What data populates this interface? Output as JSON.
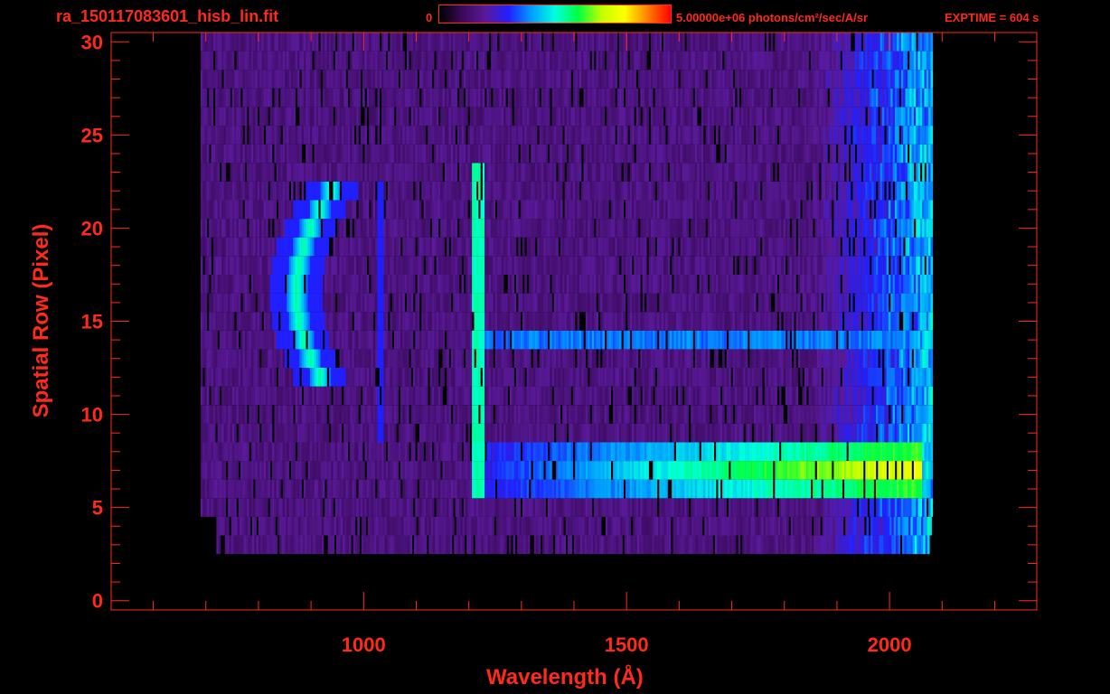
{
  "header": {
    "file_name": "ra_150117083601_hisb_lin.fit",
    "colorbar_min": "0",
    "colorbar_max": "5.00000e+06 photons/cm²/sec/A/sr",
    "exptime": "EXPTIME = 604 s"
  },
  "colors": {
    "axis": "#ff2a1a",
    "background": "#000000",
    "colormap": [
      "#000000",
      "#3a0a5a",
      "#5a1a9a",
      "#2020ff",
      "#00a0ff",
      "#00ffe0",
      "#00ff40",
      "#c0ff00",
      "#ffff00",
      "#ff8000",
      "#ff0000"
    ]
  },
  "chart_data": {
    "type": "heatmap",
    "title": "ra_150117083601_hisb_lin.fit",
    "xlabel": "Wavelength (Å)",
    "ylabel": "Spatial Row (Pixel)",
    "xlim": [
      520,
      2280
    ],
    "ylim": [
      -0.5,
      30.5
    ],
    "xticks": [
      1000,
      1500,
      2000
    ],
    "yticks": [
      0,
      5,
      10,
      15,
      20,
      25,
      30
    ],
    "colorbar_range": [
      0,
      5000000
    ],
    "colorbar_unit": "photons/cm²/sec/A/sr",
    "exptime_s": 604,
    "data_extent_x": [
      690,
      2080
    ],
    "rows": [
      3,
      30
    ],
    "features": [
      {
        "name": "Lyman-alpha",
        "wavelength": 1216,
        "rows": [
          6,
          23
        ],
        "intensity": 0.5
      },
      {
        "name": "arc",
        "wavelength_center": 840,
        "rows": [
          12,
          22
        ],
        "intensity": 0.55
      },
      {
        "name": "emission line",
        "wavelength": 1030,
        "rows": [
          9,
          22
        ],
        "intensity": 0.3
      },
      {
        "name": "continuum row 14",
        "rows": [
          14,
          14
        ],
        "wavelength_range": [
          1216,
          2060
        ],
        "intensity": 0.4
      },
      {
        "name": "continuum rows 6-8",
        "rows": [
          6,
          8
        ],
        "wavelength_range": [
          1216,
          2060
        ],
        "intensity": 0.6
      }
    ]
  }
}
